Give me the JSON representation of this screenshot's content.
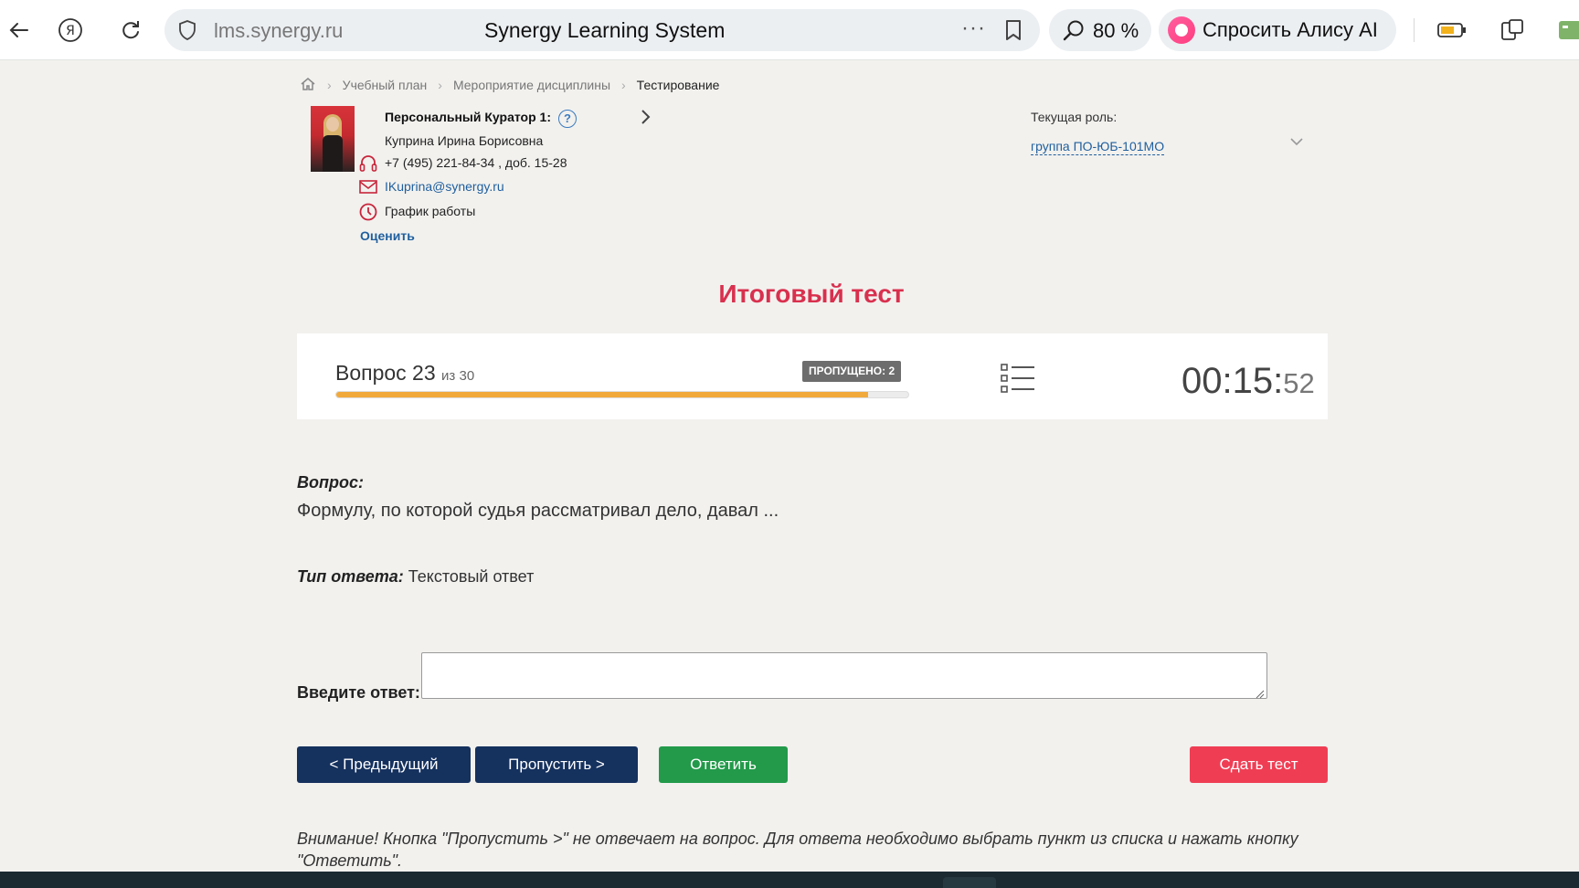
{
  "browser": {
    "host": "lms.synergy.ru",
    "page_title": "Synergy Learning System",
    "zoom": "80 %",
    "alice_label": "Спросить Алису AI"
  },
  "breadcrumb": [
    "Учебный план",
    "Мероприятие дисциплины",
    "Тестирование"
  ],
  "curator": {
    "title": "Персональный Куратор 1:",
    "name": "Куприна Ирина Борисовна",
    "phone": "+7 (495) 221-84-34 , доб. 15-28",
    "email": "IKuprina@synergy.ru",
    "schedule": "График работы",
    "rate": "Оценить"
  },
  "role": {
    "label": "Текущая роль:",
    "value": "группа ПО-ЮБ-101МО"
  },
  "test": {
    "title": "Итоговый тест",
    "question_prefix": "Вопрос 23",
    "question_of": "из 30",
    "skipped": "ПРОПУЩЕНО: 2",
    "progress_fraction": 0.93,
    "timer_main": "00:15:",
    "timer_sec": "52"
  },
  "question": {
    "label": "Вопрос:",
    "text": "Формулу, по которой судья рассматривал дело, давал ...",
    "type_label": "Тип ответа:",
    "type_value": "Текстовый ответ",
    "answer_label": "Введите ответ:",
    "answer_value": ""
  },
  "buttons": {
    "prev": "< Предыдущий",
    "skip": "Пропустить >",
    "answer": "Ответить",
    "submit": "Сдать тест"
  },
  "note": "Внимание! Кнопка \"Пропустить >\" не отвечает на вопрос. Для ответа необходимо выбрать пункт из списка и нажать кнопку \"Ответить\".",
  "colors": {
    "accent_red": "#d9304e",
    "nav_blue": "#15315e",
    "answer_green": "#229a4a",
    "submit_red": "#ef3e54",
    "progress_orange": "#f2a93b"
  }
}
